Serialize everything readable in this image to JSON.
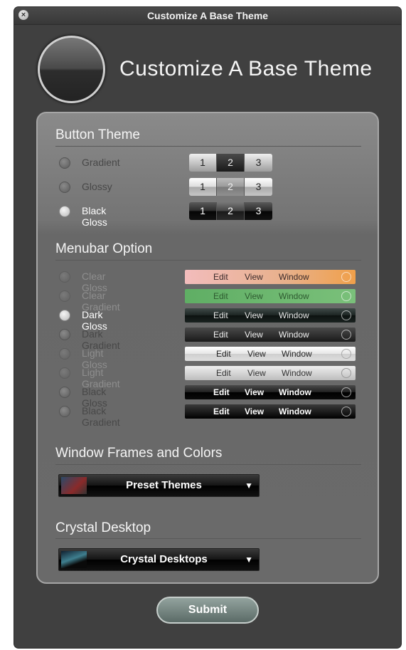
{
  "window": {
    "title": "Customize A Base Theme",
    "close_glyph": "×"
  },
  "header": {
    "title": "Customize A Base Theme",
    "orb_icon": "circle-orb-icon"
  },
  "button_theme": {
    "title": "Button Theme",
    "options": [
      {
        "label": "Gradient",
        "selected": false,
        "segments": [
          "1",
          "2",
          "3"
        ],
        "highlighted_segment": 2
      },
      {
        "label": "Glossy",
        "selected": false,
        "segments": [
          "1",
          "2",
          "3"
        ],
        "highlighted_segment": 2
      },
      {
        "label": "Black Gloss",
        "selected": true,
        "segments": [
          "1",
          "2",
          "3"
        ],
        "highlighted_segment": 2
      }
    ]
  },
  "menubar_option": {
    "title": "Menubar Option",
    "apple_glyph": "",
    "options": [
      {
        "label": "Clear Gloss",
        "selected": false,
        "items": [
          "Edit",
          "View",
          "Window"
        ]
      },
      {
        "label": "Clear Gradient",
        "selected": false,
        "items": [
          "Edit",
          "View",
          "Window"
        ]
      },
      {
        "label": "Dark Gloss",
        "selected": true,
        "items": [
          "Edit",
          "View",
          "Window"
        ]
      },
      {
        "label": "Dark Gradient",
        "selected": false,
        "items": [
          "Edit",
          "View",
          "Window"
        ]
      },
      {
        "label": "Light Gloss",
        "selected": false,
        "items": [
          "Edit",
          "View",
          "Window"
        ]
      },
      {
        "label": "Light Gradient",
        "selected": false,
        "items": [
          "Edit",
          "View",
          "Window"
        ]
      },
      {
        "label": "Black Gloss",
        "selected": false,
        "items": [
          "Edit",
          "View",
          "Window"
        ]
      },
      {
        "label": "Black Gradient",
        "selected": false,
        "items": [
          "Edit",
          "View",
          "Window"
        ]
      }
    ]
  },
  "window_frames": {
    "title": "Window Frames and Colors",
    "dropdown": {
      "value": "Preset Themes",
      "arrow": "▼"
    }
  },
  "crystal_desktop": {
    "title": "Crystal Desktop",
    "dropdown": {
      "value": "Crystal Desktops",
      "arrow": "▼"
    }
  },
  "submit": {
    "label": "Submit"
  }
}
